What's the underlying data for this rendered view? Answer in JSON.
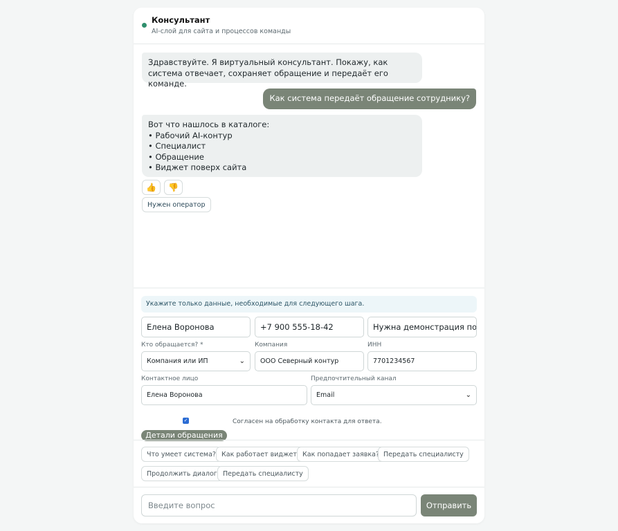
{
  "header": {
    "title": "Консультант",
    "subtitle": "AI-слой для сайта и процессов команды"
  },
  "messages": {
    "greeting": "Здравствуйте. Я виртуальный консультант. Покажу, как система отвечает, сохраняет обращение и передаёт его команде.",
    "user_question": "Как система передаёт обращение сотруднику?",
    "catalog_intro": "Вот что нашлось в каталоге:",
    "catalog_items": [
      "• Рабочий AI-контур",
      "• Специалист",
      "• Обращение",
      "• Виджет поверх сайта"
    ],
    "thumbs_up": "👍",
    "thumbs_down": "👎",
    "operator_button": "Нужен оператор"
  },
  "form": {
    "notice": "Укажите только данные, необходимые для следующего шага.",
    "name_value": "Елена Воронова",
    "phone_value": "+7 900 555-18-42",
    "need_value": "Нужна демонстрация помо",
    "who_label": "Кто обращается? *",
    "who_value": "Компания или ИП",
    "company_label": "Компания",
    "company_value": "ООО Северный контур",
    "inn_label": "ИНН",
    "inn_value": "7701234567",
    "contact_label": "Контактное лицо",
    "contact_value": "Елена Воронова",
    "channel_label": "Предпочтительный канал",
    "channel_value": "Email",
    "consent_checked": true,
    "consent_text": "Согласен на обработку контакта для ответа.",
    "details_button": "Детали обращения"
  },
  "quick_replies": [
    "Что умеет система?",
    "Как работает виджет?",
    "Как попадает заявка?",
    "Передать специалисту",
    "Продолжить диалог",
    "Передать специалисту"
  ],
  "composer": {
    "placeholder": "Введите вопрос",
    "send_label": "Отправить"
  },
  "colors": {
    "accent": "#7a8577",
    "status_online": "#2f8f6d",
    "bot_bubble": "#edf0f0",
    "notice_bg": "#edf6f9"
  }
}
